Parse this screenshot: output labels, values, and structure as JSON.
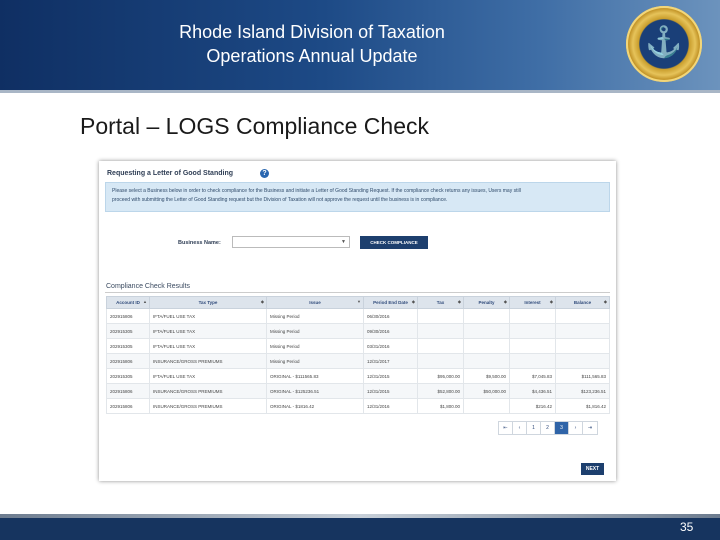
{
  "header": {
    "title_line1": "Rhode Island Division of Taxation",
    "title_line2": "Operations Annual Update"
  },
  "slide": {
    "heading": "Portal – LOGS Compliance Check",
    "page_number": "35"
  },
  "panel": {
    "title": "Requesting a Letter of Good Standing",
    "help_glyph": "?",
    "info_line1": "Please select a Business below in order to check compliance for the Business and initiate a Letter of Good Standing Request. If the compliance check returns any issues, Users may still",
    "info_line2": "proceed with submitting the Letter of Good Standing request but the Division of Taxation will not approve the request until the business is in compliance.",
    "business_name_label": "Business Name:",
    "business_name_value": "",
    "check_button": "CHECK COMPLIANCE",
    "results_title": "Compliance Check Results",
    "next_button": "NEXT"
  },
  "table": {
    "columns": [
      "Account ID",
      "Tax Type",
      "Issue",
      "Period End Date",
      "Tax",
      "Penalty",
      "Interest",
      "Balance"
    ],
    "rows": [
      [
        "202915806",
        "IFTA/FUEL USE TAX",
        "Missing Period",
        "06/30/2016",
        "",
        "",
        "",
        ""
      ],
      [
        "202915305",
        "IFTA/FUEL USE TAX",
        "Missing Period",
        "09/30/2016",
        "",
        "",
        "",
        ""
      ],
      [
        "202915305",
        "IFTA/FUEL USE TAX",
        "Missing Period",
        "03/31/2016",
        "",
        "",
        "",
        ""
      ],
      [
        "202915806",
        "INSURANCE/GROSS PREMIUMS",
        "Missing Period",
        "12/31/2017",
        "",
        "",
        "",
        ""
      ],
      [
        "202915305",
        "IFTA/FUEL USE TAX",
        "ORIGINAL - $111565.83",
        "12/31/2015",
        "$95,000.00",
        "$9,500.00",
        "$7,045.83",
        "$111,565.83"
      ],
      [
        "202915806",
        "INSURANCE/GROSS PREMIUMS",
        "ORIGINAL - $125236.51",
        "12/31/2015",
        "$52,800.00",
        "$50,000.00",
        "$4,436.51",
        "$123,236.51"
      ],
      [
        "202915806",
        "INSURANCE/GROSS PREMIUMS",
        "ORIGINAL - $1816.42",
        "12/31/2016",
        "$1,800.00",
        "",
        "$216.42",
        "$1,816.42"
      ]
    ]
  },
  "pager": {
    "first": "⇤",
    "prev": "‹",
    "pages": [
      "1",
      "2",
      "3"
    ],
    "active_page": "3",
    "next": "›",
    "last": "⇥"
  },
  "icons": {
    "seal": "state-seal-icon",
    "sort": "sort-caret-icon",
    "select": "chevron-down-icon"
  },
  "colors": {
    "header_dark": "#0f2f63",
    "button_navy": "#1d3f6e",
    "info_bg": "#d7e8f5",
    "seal_gold": "#c99d2c"
  }
}
